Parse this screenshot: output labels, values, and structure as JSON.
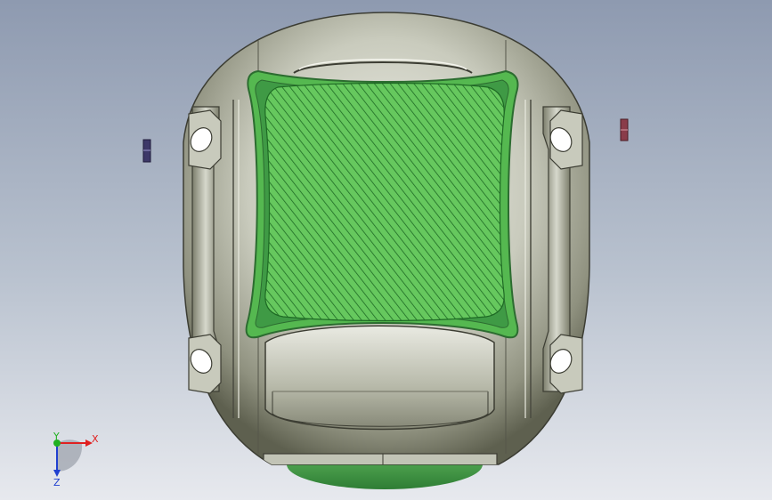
{
  "viewport": {
    "background_top": "#8e9ab0",
    "background_bottom": "#e7e9ee"
  },
  "model": {
    "body_color": "#b9bcae",
    "section_color": "#55b850",
    "section_rim_color": "#3f9a45",
    "hatch_color": "#1e6a24"
  },
  "markers": {
    "left_color": "#3d3868",
    "right_color": "#8a3c4a"
  },
  "triad": {
    "x_label": "X",
    "y_label": "Y",
    "z_label": "Z",
    "x_color": "#e02020",
    "y_color": "#20b020",
    "z_color": "#2040d0"
  }
}
